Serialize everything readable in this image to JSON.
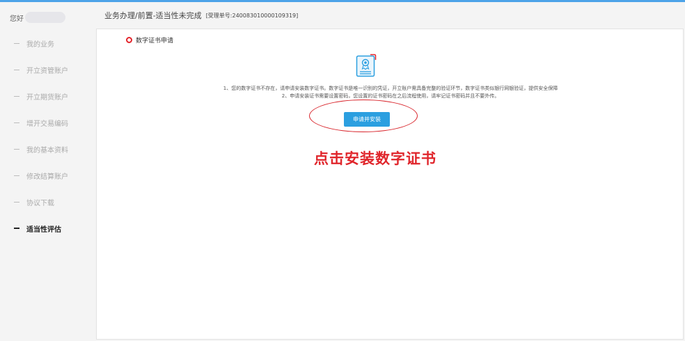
{
  "sidebar": {
    "greeting": "您好",
    "items": [
      {
        "label": "我的业务"
      },
      {
        "label": "开立资管账户"
      },
      {
        "label": "开立期货账户"
      },
      {
        "label": "增开交易编码"
      },
      {
        "label": "我的基本资料"
      },
      {
        "label": "修改结算账户"
      },
      {
        "label": "协议下载"
      },
      {
        "label": "适当性评估",
        "active": true
      }
    ]
  },
  "header": {
    "title": "业务办理/前置-适当性未完成",
    "order": "[受理单号:240083010000109319]"
  },
  "main": {
    "section_title": "数字证书申请",
    "notes": [
      "1、您的数字证书不存在，请申请安装数字证书。数字证书是唯一识别的凭证，开立账户需具备完整的验证环节，数字证书类似银行网银验证，提供安全保障",
      "2、申请安装证书需要设置密码，您设置的证书密码在之后流程使用，请牢记证书密码并且不要外传。"
    ],
    "apply_button": "申请并安装",
    "annotation": "点击安装数字证书"
  },
  "colors": {
    "accent": "#2b9fe0",
    "annotation_red": "#e0252b",
    "topbar": "#4da3e8"
  },
  "icons": {
    "section": "red-ring-icon",
    "certificate": "certificate-icon"
  }
}
